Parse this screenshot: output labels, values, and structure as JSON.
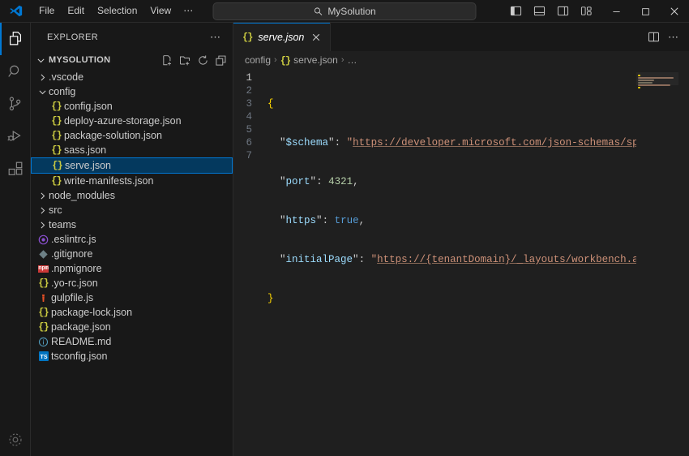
{
  "titlebar": {
    "logo_icon": "vscode-logo-icon",
    "menus": [
      {
        "label": "File",
        "name": "menu-file"
      },
      {
        "label": "Edit",
        "name": "menu-edit"
      },
      {
        "label": "Selection",
        "name": "menu-selection"
      },
      {
        "label": "View",
        "name": "menu-view"
      },
      {
        "label": "⋯",
        "name": "menu-more"
      }
    ],
    "nav_back_icon": "arrow-left-icon",
    "nav_forward_icon": "arrow-right-icon",
    "search": {
      "value": "MySolution",
      "placeholder": "Search",
      "icon": "search-icon"
    },
    "layout_buttons": [
      {
        "name": "toggle-primary-sidebar-button",
        "icon": "layout-sidebar-left-icon"
      },
      {
        "name": "toggle-panel-button",
        "icon": "layout-panel-bottom-icon"
      },
      {
        "name": "toggle-secondary-sidebar-button",
        "icon": "layout-sidebar-right-icon"
      },
      {
        "name": "customize-layout-button",
        "icon": "layout-customize-icon"
      }
    ],
    "window_controls": [
      {
        "name": "minimize-button",
        "icon": "minimize-icon"
      },
      {
        "name": "maximize-button",
        "icon": "maximize-icon"
      },
      {
        "name": "close-button",
        "icon": "close-icon"
      }
    ]
  },
  "activitybar": {
    "items": [
      {
        "name": "activity-explorer",
        "icon": "files-icon",
        "active": true
      },
      {
        "name": "activity-search",
        "icon": "search-icon",
        "active": false
      },
      {
        "name": "activity-source-control",
        "icon": "source-control-icon",
        "active": false
      },
      {
        "name": "activity-run-debug",
        "icon": "run-and-debug-icon",
        "active": false
      },
      {
        "name": "activity-extensions",
        "icon": "extensions-icon",
        "active": false
      }
    ],
    "manage": {
      "name": "activity-manage-settings",
      "icon": "gear-icon"
    }
  },
  "sidebar": {
    "title": "EXPLORER",
    "more_label": "⋯",
    "root": {
      "label": "MYSOLUTION",
      "expanded": true,
      "actions": [
        {
          "name": "new-file-button",
          "icon": "new-file-icon"
        },
        {
          "name": "new-folder-button",
          "icon": "new-folder-icon"
        },
        {
          "name": "refresh-explorer-button",
          "icon": "refresh-icon"
        },
        {
          "name": "collapse-folders-button",
          "icon": "collapse-all-icon"
        }
      ]
    },
    "tree": [
      {
        "label": ".vscode",
        "type": "folder",
        "expanded": false,
        "depth": 1,
        "icon": "chevron-right-icon"
      },
      {
        "label": "config",
        "type": "folder",
        "expanded": true,
        "depth": 1,
        "icon": "chevron-down-icon"
      },
      {
        "label": "config.json",
        "type": "json",
        "depth": 2,
        "icon": "json-file-icon"
      },
      {
        "label": "deploy-azure-storage.json",
        "type": "json",
        "depth": 2,
        "icon": "json-file-icon"
      },
      {
        "label": "package-solution.json",
        "type": "json",
        "depth": 2,
        "icon": "json-file-icon"
      },
      {
        "label": "sass.json",
        "type": "json",
        "depth": 2,
        "icon": "json-file-icon"
      },
      {
        "label": "serve.json",
        "type": "json",
        "depth": 2,
        "icon": "json-file-icon",
        "selected": true
      },
      {
        "label": "write-manifests.json",
        "type": "json",
        "depth": 2,
        "icon": "json-file-icon"
      },
      {
        "label": "node_modules",
        "type": "folder",
        "expanded": false,
        "depth": 1,
        "icon": "chevron-right-icon"
      },
      {
        "label": "src",
        "type": "folder",
        "expanded": false,
        "depth": 1,
        "icon": "chevron-right-icon"
      },
      {
        "label": "teams",
        "type": "folder",
        "expanded": false,
        "depth": 1,
        "icon": "chevron-right-icon"
      },
      {
        "label": ".eslintrc.js",
        "type": "eslint",
        "depth": 1,
        "icon": "eslint-file-icon"
      },
      {
        "label": ".gitignore",
        "type": "git",
        "depth": 1,
        "icon": "git-file-icon"
      },
      {
        "label": ".npmignore",
        "type": "npm",
        "depth": 1,
        "icon": "npm-file-icon"
      },
      {
        "label": ".yo-rc.json",
        "type": "json",
        "depth": 1,
        "icon": "json-file-icon"
      },
      {
        "label": "gulpfile.js",
        "type": "gulp",
        "depth": 1,
        "icon": "gulp-file-icon"
      },
      {
        "label": "package-lock.json",
        "type": "json",
        "depth": 1,
        "icon": "json-file-icon"
      },
      {
        "label": "package.json",
        "type": "json",
        "depth": 1,
        "icon": "json-file-icon"
      },
      {
        "label": "README.md",
        "type": "md",
        "depth": 1,
        "icon": "markdown-file-icon"
      },
      {
        "label": "tsconfig.json",
        "type": "ts",
        "depth": 1,
        "icon": "tsconfig-file-icon"
      }
    ]
  },
  "editor": {
    "tabs": [
      {
        "label": "serve.json",
        "icon": "json-file-icon",
        "preview": true,
        "active": true,
        "close_icon": "close-icon"
      }
    ],
    "actions": [
      {
        "name": "split-editor-right-button",
        "icon": "split-editor-icon"
      },
      {
        "name": "editor-more-actions-button",
        "icon": "ellipsis-icon",
        "label": "⋯"
      }
    ],
    "breadcrumbs": [
      {
        "label": "config",
        "icon": null
      },
      {
        "label": "serve.json",
        "icon": "json-file-icon"
      },
      {
        "label": "…",
        "icon": null
      }
    ],
    "breadcrumb_separator": "›",
    "line_numbers": [
      "1",
      "2",
      "3",
      "4",
      "5",
      "6",
      "7"
    ],
    "current_line": 1,
    "json_document": {
      "$schema": "https://developer.microsoft.com/json-schemas/spfx-build/spfx-serve.schema.json",
      "port": 4321,
      "https": true,
      "initialPage": "https://{tenantDomain}/_layouts/workbench.aspx"
    },
    "code_lines": [
      {
        "n": 1,
        "text": "{"
      },
      {
        "n": 2,
        "text": "  \"$schema\": \"https://developer.microsoft.com/json-schemas/spfx-build"
      },
      {
        "n": 3,
        "text": "  \"port\": 4321,"
      },
      {
        "n": 4,
        "text": "  \"https\": true,"
      },
      {
        "n": 5,
        "text": "  \"initialPage\": \"https://{tenantDomain}/_layouts/workbench.aspx\""
      },
      {
        "n": 6,
        "text": "}"
      },
      {
        "n": 7,
        "text": ""
      }
    ],
    "minimap": {
      "visible": true,
      "name": "minimap"
    }
  },
  "colors": {
    "accent": "#0078d4",
    "titlebar_bg": "#181818",
    "sidebar_bg": "#181818",
    "editor_bg": "#1f1f1f",
    "selection_bg": "#04395e",
    "json_icon": "#cbcb41",
    "string": "#ce9178",
    "key": "#9cdcfe",
    "number": "#b5cea8",
    "boolean": "#569cd6",
    "brace": "#ffd700"
  }
}
